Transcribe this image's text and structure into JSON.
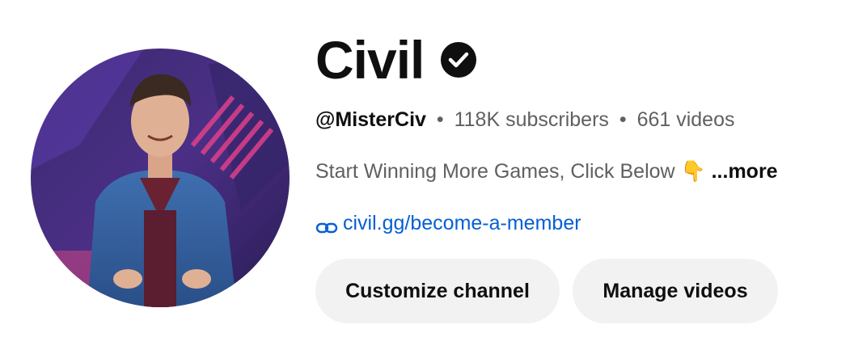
{
  "channel": {
    "name": "Civil",
    "handle": "@MisterCiv",
    "separator": "•",
    "subscribers": "118K subscribers",
    "videos": "661 videos",
    "description": "Start Winning More Games, Click Below 👇",
    "more_label": "...more",
    "link": "civil.gg/become-a-member"
  },
  "actions": {
    "customize_label": "Customize channel",
    "manage_label": "Manage videos"
  },
  "icons": {
    "verified": "verified-check-icon",
    "link": "link-icon"
  },
  "colors": {
    "text_primary": "#0f0f0f",
    "text_secondary": "#606060",
    "link": "#065fd4",
    "button_bg": "#f2f2f2"
  }
}
